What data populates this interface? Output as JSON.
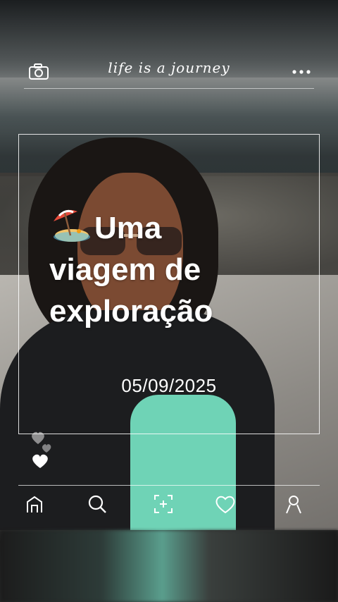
{
  "header": {
    "brand": "life is a journey",
    "camera_icon": "camera-icon",
    "more_icon": "more-dots-icon"
  },
  "card": {
    "title_line1": "Uma",
    "title_line2": "viagem de",
    "title_line3": "exploração",
    "emoji": "umbrella-on-beach-icon",
    "date": "05/09/2025"
  },
  "nav": {
    "items": [
      {
        "icon": "home-icon"
      },
      {
        "icon": "search-icon"
      },
      {
        "icon": "add-photo-icon"
      },
      {
        "icon": "heart-icon"
      },
      {
        "icon": "profile-icon"
      }
    ]
  },
  "colors": {
    "overlay": "#ffffff",
    "shirt": "#6fd3b6"
  }
}
